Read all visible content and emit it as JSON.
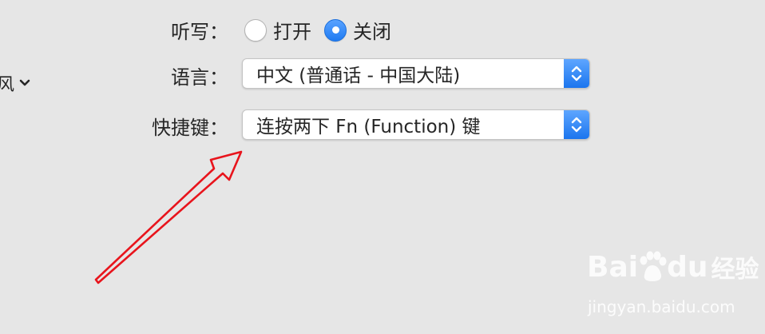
{
  "sidebar_partial": {
    "text": "风",
    "icon": "chevron-down-icon"
  },
  "dictation": {
    "label": "听写：",
    "options": [
      {
        "label": "打开",
        "selected": false
      },
      {
        "label": "关闭",
        "selected": true
      }
    ]
  },
  "language": {
    "label": "语言：",
    "value": "中文 (普通话 - 中国大陆)"
  },
  "shortcut": {
    "label": "快捷键：",
    "value": "连按两下 Fn (Function) 键"
  },
  "annotation": {
    "type": "arrow",
    "color": "#e8141c"
  },
  "watermark": {
    "brand_latin_1": "Bai",
    "brand_latin_2": "du",
    "brand_cn": "经验",
    "url": "jingyan.baidu.com"
  },
  "colors": {
    "background": "#e6e6e6",
    "accent": "#1f7bf2",
    "arrow": "#e8141c"
  }
}
